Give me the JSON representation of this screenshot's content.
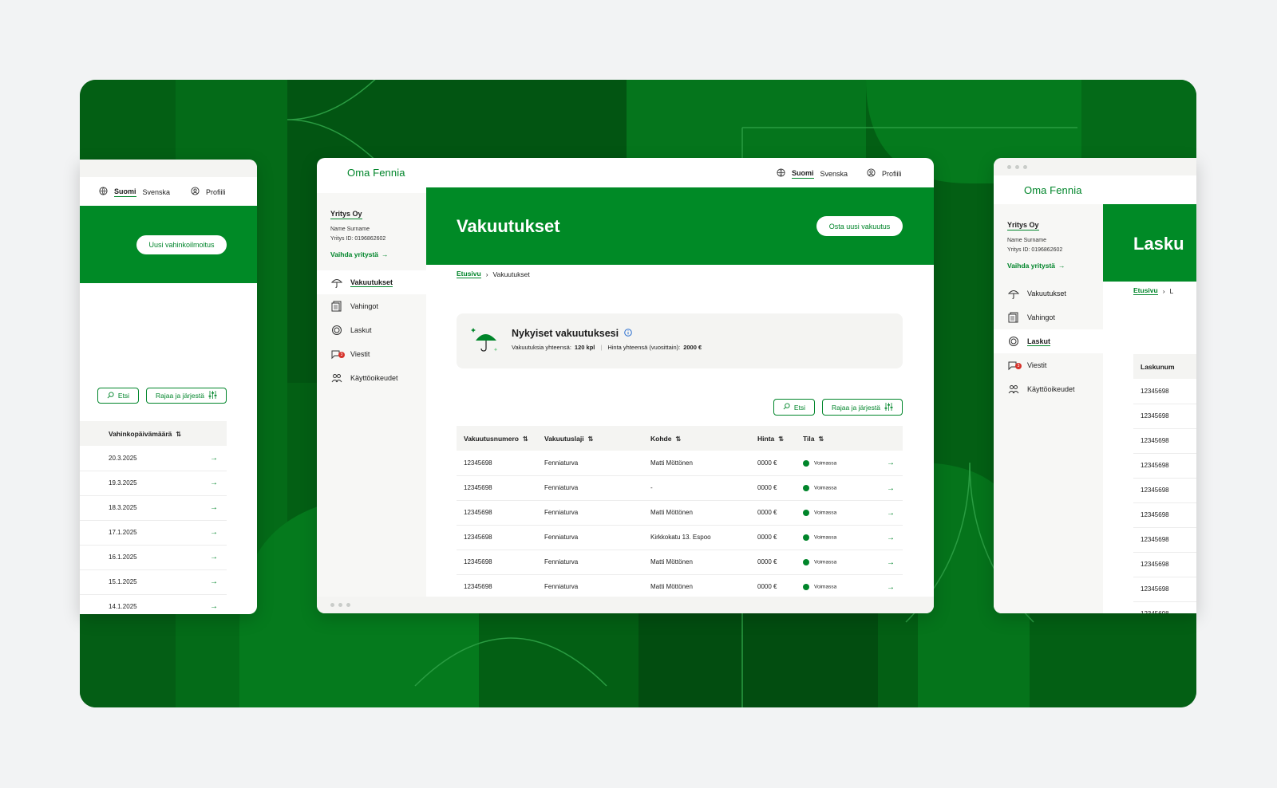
{
  "colors": {
    "brand_green": "#008a26",
    "dark_green": "#025a12",
    "badge_red": "#d6332b"
  },
  "app": {
    "logo": "Oma Fennia"
  },
  "header": {
    "lang_current": "Suomi",
    "lang_other": "Svenska",
    "profile": "Profiili"
  },
  "sidebar": {
    "company": "Yritys Oy",
    "name": "Name Surname",
    "company_id": "Yritys ID: 0196862602",
    "switch": "Vaihda yritystä",
    "items": [
      {
        "label": "Vakuutukset",
        "icon": "umbrella-icon"
      },
      {
        "label": "Vahingot",
        "icon": "documents-icon"
      },
      {
        "label": "Laskut",
        "icon": "coins-icon"
      },
      {
        "label": "Viestit",
        "icon": "messages-icon",
        "badge": "3"
      },
      {
        "label": "Käyttöoikeudet",
        "icon": "users-icon"
      }
    ]
  },
  "left": {
    "cta": "Uusi vahinkoilmoitus",
    "search": "Etsi",
    "filter": "Rajaa ja järjestä",
    "column": "Vahinkopäivämäärä",
    "dates": [
      "20.3.2025",
      "19.3.2025",
      "18.3.2025",
      "17.1.2025",
      "16.1.2025",
      "15.1.2025",
      "14.1.2025"
    ]
  },
  "center": {
    "title": "Vakuutukset",
    "cta": "Osta uusi vakuutus",
    "breadcrumb": [
      "Etusivu",
      "Vakuutukset"
    ],
    "summary": {
      "title": "Nykyiset vakuutuksesi",
      "count_label": "Vakuutuksia yhteensä:",
      "count_value": "120 kpl",
      "price_label": "Hinta yhteensä (vuosittain):",
      "price_value": "2000 €"
    },
    "search": "Etsi",
    "filter": "Rajaa ja järjestä",
    "columns": [
      "Vakuutusnumero",
      "Vakuutuslaji",
      "Kohde",
      "Hinta",
      "Tila"
    ],
    "rows": [
      [
        "12345698",
        "Fenniaturva",
        "Matti Möttönen",
        "0000 €",
        "Voimassa"
      ],
      [
        "12345698",
        "Fenniaturva",
        "-",
        "0000 €",
        "Voimassa"
      ],
      [
        "12345698",
        "Fenniaturva",
        "Matti Möttönen",
        "0000 €",
        "Voimassa"
      ],
      [
        "12345698",
        "Fenniaturva",
        "Kirkkokatu 13. Espoo",
        "0000 €",
        "Voimassa"
      ],
      [
        "12345698",
        "Fenniaturva",
        "Matti Möttönen",
        "0000 €",
        "Voimassa"
      ],
      [
        "12345698",
        "Fenniaturva",
        "Matti Möttönen",
        "0000 €",
        "Voimassa"
      ]
    ]
  },
  "right": {
    "title_partial": "Lasku",
    "breadcrumb_first": "Etusivu",
    "breadcrumb_partial": "L",
    "column_partial": "Laskunum",
    "rows": [
      "12345698",
      "12345698",
      "12345698",
      "12345698",
      "12345698",
      "12345698",
      "12345698",
      "12345698",
      "12345698",
      "12345698"
    ]
  }
}
